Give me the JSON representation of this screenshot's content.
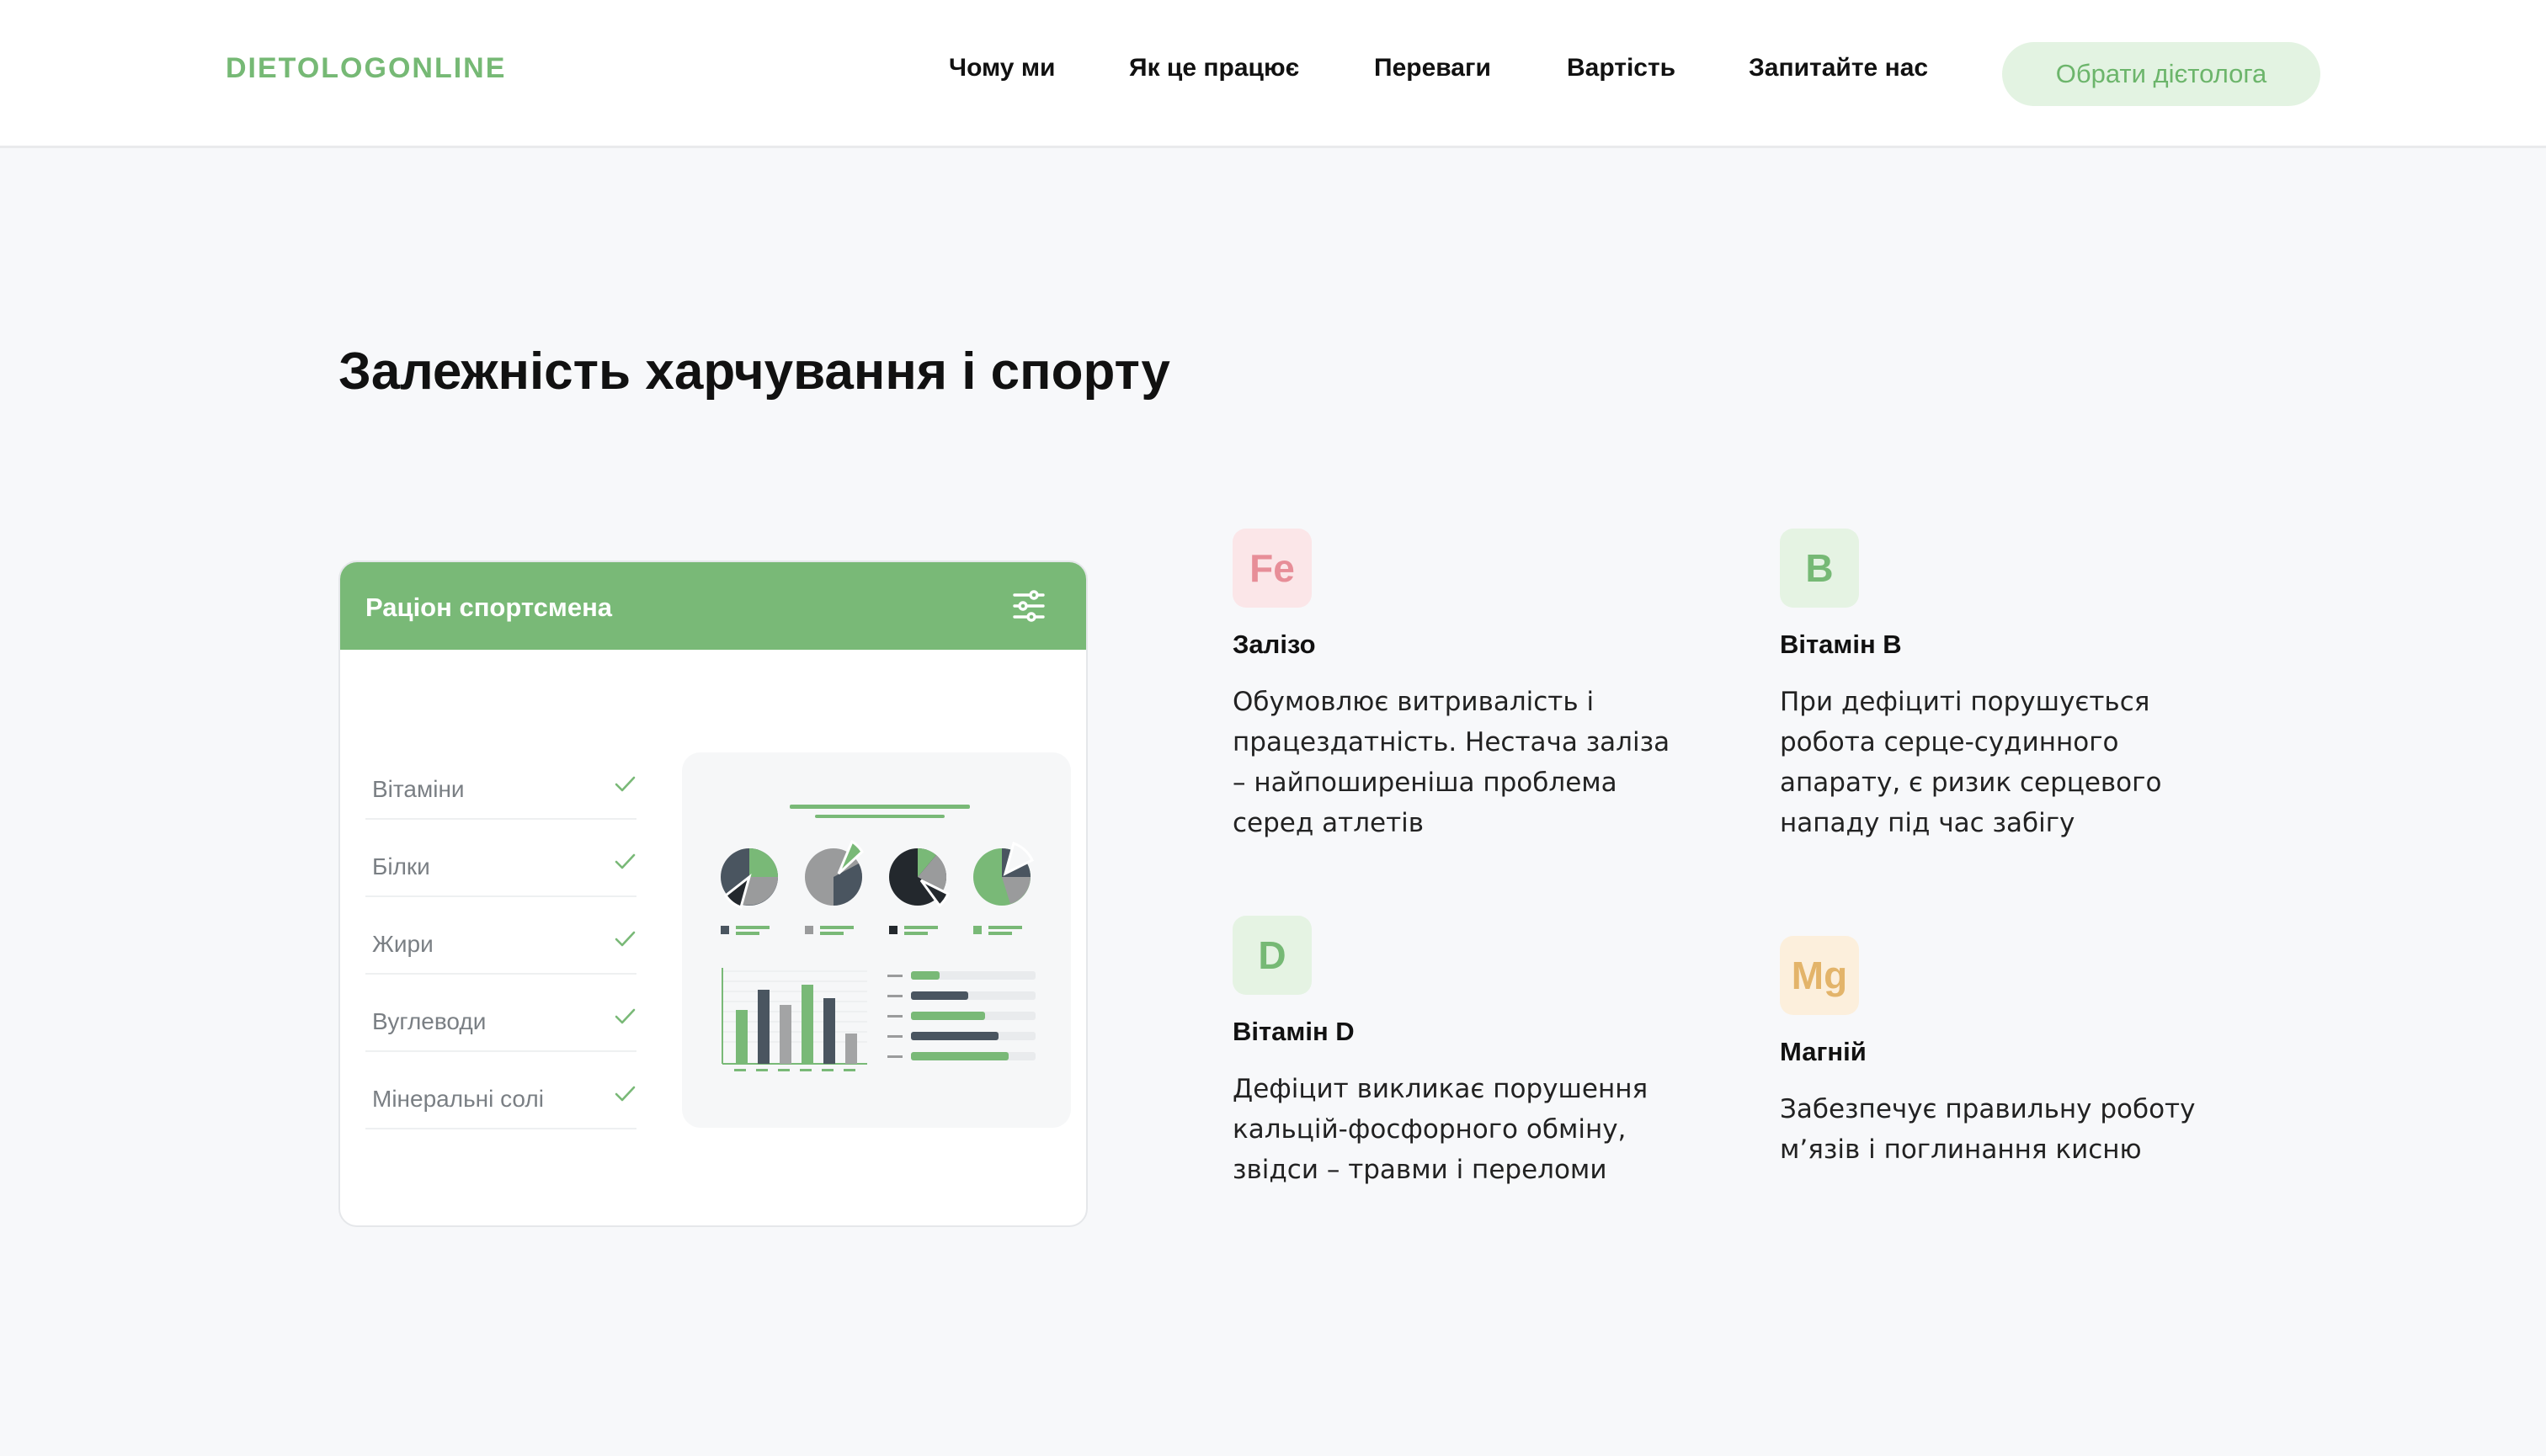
{
  "brand": {
    "logo": "DIETOLOGONLINE",
    "accent_color": "#76b975"
  },
  "nav": {
    "items": [
      {
        "label": "Чому ми"
      },
      {
        "label": "Як це працює"
      },
      {
        "label": "Переваги"
      },
      {
        "label": "Вартість"
      },
      {
        "label": "Запитайте нас"
      }
    ],
    "cta_label": "Обрати дієтолога"
  },
  "section": {
    "title": "Залежність харчування і спорту"
  },
  "card": {
    "title": "Раціон спортсмена",
    "header_icon": "sliders-icon",
    "checklist": [
      {
        "label": "Вітаміни"
      },
      {
        "label": "Білки"
      },
      {
        "label": "Жири"
      },
      {
        "label": "Вуглеводи"
      },
      {
        "label": "Мінеральні солі"
      }
    ],
    "dashboard_icon": "analytics-dashboard-illustration"
  },
  "nutrients": [
    {
      "symbol": "Fe",
      "name": "Залізо",
      "desc": "Обумовлює витривалість і працездатність. Нестача заліза – найпоширеніша проблема серед атлетів",
      "color": "#e78e98",
      "bg": "#fbe6e8"
    },
    {
      "symbol": "B",
      "name": "Вітамін B",
      "desc": "При дефіциті порушується робота серце-судинного апарату, є ризик серцевого нападу під час забігу",
      "color": "#76b975",
      "bg": "#e5f3e3"
    },
    {
      "symbol": "D",
      "name": "Вітамін D",
      "desc": "Дефіцит викликає порушення кальцій-фосфорного обміну, звідси – травми і переломи",
      "color": "#76b975",
      "bg": "#e5f3e3"
    },
    {
      "symbol": "Mg",
      "name": "Магній",
      "desc": "Забезпечує правильну роботу м’язів і поглинання кисню",
      "color": "#e3b46a",
      "bg": "#fcefdc"
    }
  ]
}
